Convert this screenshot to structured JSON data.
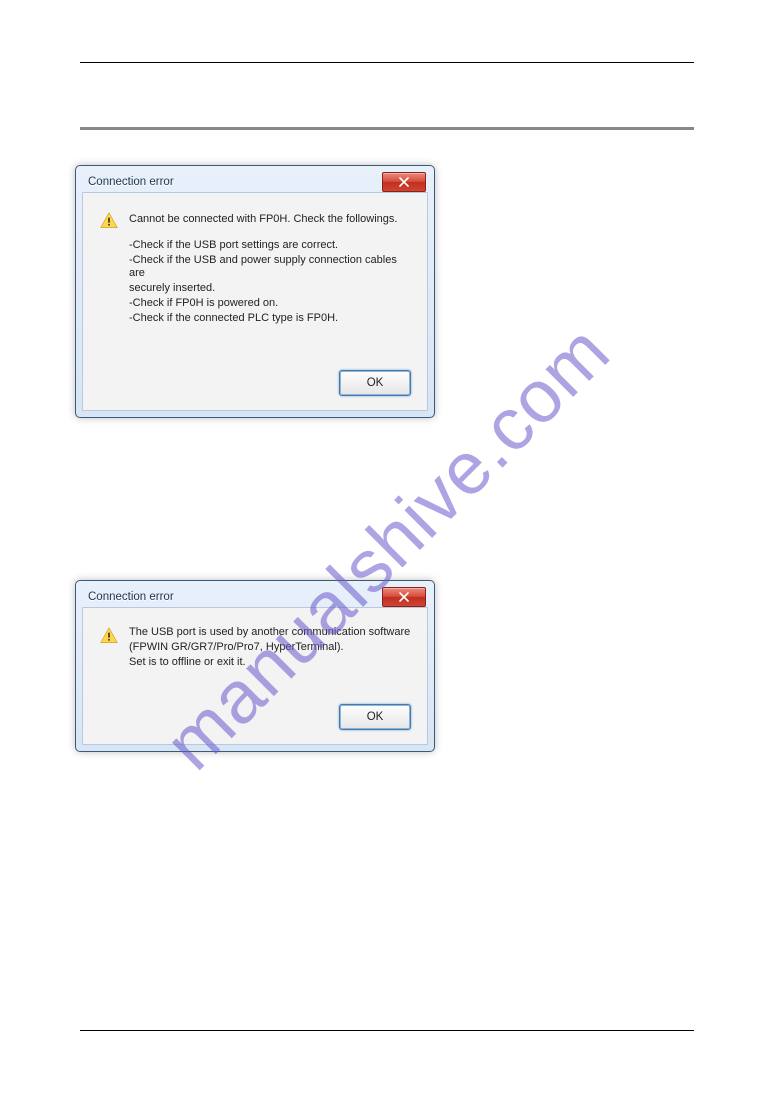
{
  "watermark": "manualshive.com",
  "dialog1": {
    "title": "Connection error",
    "heading": "Cannot be connected with FP0H. Check the followings.",
    "lines": [
      "-Check if the USB port settings are correct.",
      "-Check if the USB and power supply connection cables are",
      "securely inserted.",
      "-Check if FP0H is powered on.",
      "-Check if the connected PLC type is FP0H."
    ],
    "ok_label": "OK"
  },
  "dialog2": {
    "title": "Connection error",
    "heading": "",
    "lines": [
      "The USB port is used by another communication software",
      "(FPWIN GR/GR7/Pro/Pro7, HyperTerminal).",
      "Set is to offline or exit it."
    ],
    "ok_label": "OK"
  }
}
